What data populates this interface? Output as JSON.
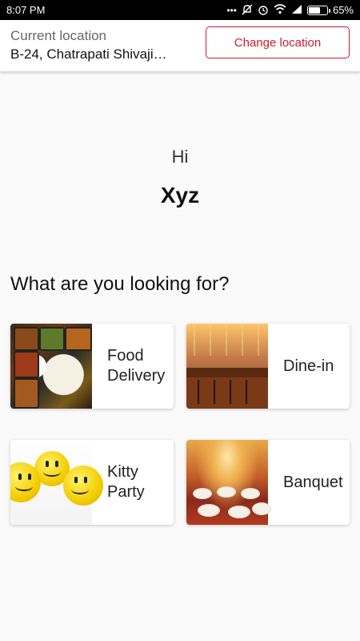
{
  "status_bar": {
    "time": "8:07 PM",
    "icons": [
      "more-dots-icon",
      "mute-icon",
      "alarm-icon",
      "wifi-icon",
      "signal-icon",
      "battery-icon"
    ],
    "battery_percent": "65%",
    "battery_level": 0.65
  },
  "header": {
    "location_label": "Current location",
    "location_value": "B-24, Chatrapati Shivaji…",
    "change_location_label": "Change location"
  },
  "greeting": {
    "hi": "Hi",
    "name": "Xyz"
  },
  "section_title": "What are you looking for?",
  "options": [
    {
      "label_line1": "Food",
      "label_line2": "Delivery",
      "image": "food-delivery-photo"
    },
    {
      "label_line1": "Dine-in",
      "label_line2": "",
      "image": "dine-in-photo"
    },
    {
      "label_line1": "Kitty",
      "label_line2": "Party",
      "image": "kitty-party-photo"
    },
    {
      "label_line1": "Banquet",
      "label_line2": "",
      "image": "banquet-photo"
    }
  ],
  "colors": {
    "accent": "#d11a2a",
    "background": "#fafafa",
    "status_bar": "#000000"
  }
}
